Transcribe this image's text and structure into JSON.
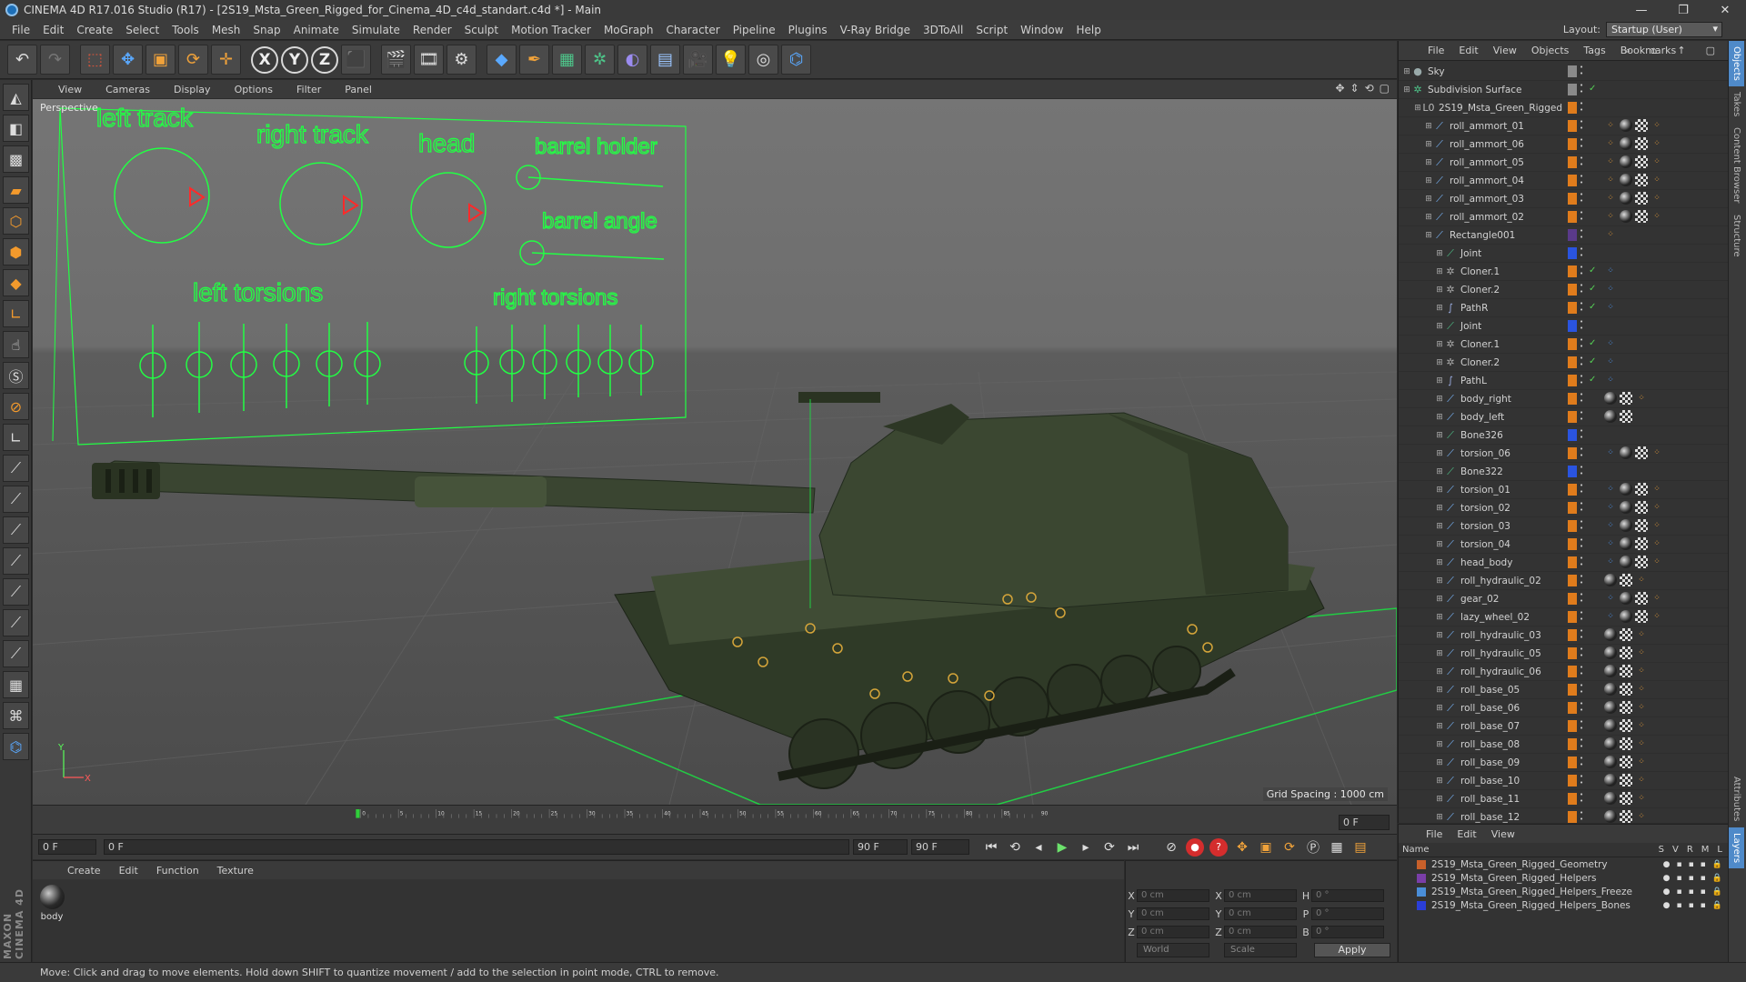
{
  "window": {
    "title": "CINEMA 4D R17.016 Studio (R17) - [2S19_Msta_Green_Rigged_for_Cinema_4D_c4d_standart.c4d *] - Main",
    "controls": [
      "—",
      "❐",
      "✕"
    ]
  },
  "menu": [
    "File",
    "Edit",
    "Create",
    "Select",
    "Tools",
    "Mesh",
    "Snap",
    "Animate",
    "Simulate",
    "Render",
    "Sculpt",
    "Motion Tracker",
    "MoGraph",
    "Character",
    "Pipeline",
    "Plugins",
    "V-Ray Bridge",
    "3DToAll",
    "Script",
    "Window",
    "Help"
  ],
  "layout": {
    "label": "Layout:",
    "value": "Startup (User)"
  },
  "toolbar": {
    "icons": [
      "undo-icon",
      "redo-icon",
      "live-selection-icon",
      "move-icon",
      "scale-icon",
      "rotate-icon",
      "recent-tools-icon",
      "x-axis-lock-icon",
      "y-axis-lock-icon",
      "z-axis-lock-icon",
      "coordinate-system-icon",
      "render-view-icon",
      "render-picture-viewer-icon",
      "edit-render-settings-icon",
      "cube-icon",
      "pen-spline-icon",
      "subdivision-icon",
      "cloner-icon",
      "deformer-icon",
      "floor-icon",
      "camera-icon",
      "light-icon",
      "cinema-logo-icon",
      "python-icon"
    ],
    "xyz": [
      "X",
      "Y",
      "Z"
    ]
  },
  "left_tools": [
    "make-editable-icon",
    "model-mode-icon",
    "texture-mode-icon",
    "workplane-icon",
    "points-mode-icon",
    "edges-mode-icon",
    "polygons-mode-icon",
    "axis-mode-icon",
    "tweak-mode-icon",
    "solo-icon",
    "snap-icon",
    "live-selection-tool-icon",
    "rigging-icon-1",
    "rigging-icon-2",
    "rigging-icon-3",
    "rigging-icon-4",
    "rigging-icon-5",
    "rigging-icon-6",
    "rigging-icon-7",
    "workplane-grid-icon",
    "deform-icon",
    "python-script-icon"
  ],
  "brand": "MAXON CINEMA 4D",
  "viewport": {
    "menu": [
      "View",
      "Cameras",
      "Display",
      "Options",
      "Filter",
      "Panel"
    ],
    "camera": "Perspective",
    "grid_spacing": "Grid Spacing : 1000 cm",
    "hud_labels": {
      "left_track": "left track",
      "right_track": "right track",
      "head": "head",
      "barrel_holder": "barrel holder",
      "barrel_angle": "barrel angle",
      "left_torsions": "left torsions",
      "right_torsions": "right torsions"
    },
    "axis": {
      "y": "Y",
      "x": "X"
    }
  },
  "timeline": {
    "ticks": [
      "0",
      "5",
      "10",
      "15",
      "20",
      "25",
      "30",
      "35",
      "40",
      "45",
      "50",
      "55",
      "60",
      "65",
      "70",
      "75",
      "80",
      "85",
      "90"
    ],
    "current_frame": "0 F",
    "start": "0 F",
    "preview_start": "0 F",
    "preview_end": "90 F",
    "end": "90 F"
  },
  "material_manager": {
    "menu": [
      "Create",
      "Edit",
      "Function",
      "Texture"
    ],
    "materials": [
      {
        "name": "body"
      }
    ]
  },
  "coordinates": {
    "rows": [
      {
        "a": "X",
        "av": "0 cm",
        "b": "X",
        "bv": "0 cm",
        "c": "H",
        "cv": "0 °"
      },
      {
        "a": "Y",
        "av": "0 cm",
        "b": "Y",
        "bv": "0 cm",
        "c": "P",
        "cv": "0 °"
      },
      {
        "a": "Z",
        "av": "0 cm",
        "b": "Z",
        "bv": "0 cm",
        "c": "B",
        "cv": "0 °"
      }
    ],
    "mode1": "World",
    "mode2": "Scale",
    "apply": "Apply"
  },
  "status": "Move: Click and drag to move elements. Hold down SHIFT to quantize movement / add to the selection in point mode, CTRL to remove.",
  "object_manager": {
    "menu": [
      "File",
      "Edit",
      "View",
      "Objects",
      "Tags",
      "Bookmarks"
    ],
    "objects": [
      {
        "name": "Sky",
        "depth": 0,
        "icon": "sky",
        "color": "#8a8a8a",
        "tags": []
      },
      {
        "name": "Subdivision Surface",
        "depth": 0,
        "icon": "subdiv",
        "color": "#8a8a8a",
        "tags": [],
        "check": true
      },
      {
        "name": "2S19_Msta_Green_Rigged",
        "depth": 1,
        "icon": "null",
        "color": "#e07c1c",
        "tags": []
      },
      {
        "name": "roll_ammort_01",
        "depth": 2,
        "icon": "bone",
        "color": "#e07c1c",
        "tags": [
          "dots",
          "ball",
          "check",
          "dots"
        ]
      },
      {
        "name": "roll_ammort_06",
        "depth": 2,
        "icon": "bone",
        "color": "#e07c1c",
        "tags": [
          "dots",
          "ball",
          "check",
          "dots"
        ]
      },
      {
        "name": "roll_ammort_05",
        "depth": 2,
        "icon": "bone",
        "color": "#e07c1c",
        "tags": [
          "dots",
          "ball",
          "check",
          "dots"
        ]
      },
      {
        "name": "roll_ammort_04",
        "depth": 2,
        "icon": "bone",
        "color": "#e07c1c",
        "tags": [
          "dots",
          "ball",
          "check",
          "dots"
        ]
      },
      {
        "name": "roll_ammort_03",
        "depth": 2,
        "icon": "bone",
        "color": "#e07c1c",
        "tags": [
          "dots",
          "ball",
          "check",
          "dots"
        ]
      },
      {
        "name": "roll_ammort_02",
        "depth": 2,
        "icon": "bone",
        "color": "#e07c1c",
        "tags": [
          "dots",
          "ball",
          "check",
          "dots"
        ]
      },
      {
        "name": "Rectangle001",
        "depth": 2,
        "icon": "bone",
        "color": "#5a3a8a",
        "tags": [
          "dots"
        ]
      },
      {
        "name": "Joint",
        "depth": 3,
        "icon": "joint",
        "color": "#2a54e0",
        "tags": []
      },
      {
        "name": "Cloner.1",
        "depth": 3,
        "icon": "cloner",
        "color": "#e07c1c",
        "tags": [
          "blue"
        ],
        "check": true
      },
      {
        "name": "Cloner.2",
        "depth": 3,
        "icon": "cloner",
        "color": "#e07c1c",
        "tags": [
          "blue"
        ],
        "check": true
      },
      {
        "name": "PathR",
        "depth": 3,
        "icon": "spline",
        "color": "#e07c1c",
        "tags": [
          "blue"
        ],
        "check": true
      },
      {
        "name": "Joint",
        "depth": 3,
        "icon": "joint",
        "color": "#2a54e0",
        "tags": []
      },
      {
        "name": "Cloner.1",
        "depth": 3,
        "icon": "cloner",
        "color": "#e07c1c",
        "tags": [
          "blue"
        ],
        "check": true
      },
      {
        "name": "Cloner.2",
        "depth": 3,
        "icon": "cloner",
        "color": "#e07c1c",
        "tags": [
          "blue"
        ],
        "check": true
      },
      {
        "name": "PathL",
        "depth": 3,
        "icon": "spline",
        "color": "#e07c1c",
        "tags": [
          "blue"
        ],
        "check": true
      },
      {
        "name": "body_right",
        "depth": 3,
        "icon": "bone",
        "color": "#e07c1c",
        "tags": [
          "ball",
          "check",
          "dots"
        ]
      },
      {
        "name": "body_left",
        "depth": 3,
        "icon": "bone",
        "color": "#e07c1c",
        "tags": [
          "ball",
          "check"
        ]
      },
      {
        "name": "Bone326",
        "depth": 3,
        "icon": "joint",
        "color": "#2a54e0",
        "tags": []
      },
      {
        "name": "torsion_06",
        "depth": 3,
        "icon": "bone",
        "color": "#e07c1c",
        "tags": [
          "blue",
          "ball",
          "check",
          "dots"
        ]
      },
      {
        "name": "Bone322",
        "depth": 3,
        "icon": "joint",
        "color": "#2a54e0",
        "tags": []
      },
      {
        "name": "torsion_01",
        "depth": 3,
        "icon": "bone",
        "color": "#e07c1c",
        "tags": [
          "blue",
          "ball",
          "check",
          "dots"
        ]
      },
      {
        "name": "torsion_02",
        "depth": 3,
        "icon": "bone",
        "color": "#e07c1c",
        "tags": [
          "blue",
          "ball",
          "check",
          "dots"
        ]
      },
      {
        "name": "torsion_03",
        "depth": 3,
        "icon": "bone",
        "color": "#e07c1c",
        "tags": [
          "blue",
          "ball",
          "check",
          "dots"
        ]
      },
      {
        "name": "torsion_04",
        "depth": 3,
        "icon": "bone",
        "color": "#e07c1c",
        "tags": [
          "blue",
          "ball",
          "check",
          "dots"
        ]
      },
      {
        "name": "head_body",
        "depth": 3,
        "icon": "bone",
        "color": "#e07c1c",
        "tags": [
          "blue",
          "ball",
          "check",
          "dots"
        ]
      },
      {
        "name": "roll_hydraulic_02",
        "depth": 3,
        "icon": "bone",
        "color": "#e07c1c",
        "tags": [
          "ball",
          "check",
          "dots"
        ]
      },
      {
        "name": "gear_02",
        "depth": 3,
        "icon": "bone",
        "color": "#e07c1c",
        "tags": [
          "blue",
          "ball",
          "check",
          "dots"
        ]
      },
      {
        "name": "lazy_wheel_02",
        "depth": 3,
        "icon": "bone",
        "color": "#e07c1c",
        "tags": [
          "blue",
          "ball",
          "check",
          "dots"
        ]
      },
      {
        "name": "roll_hydraulic_03",
        "depth": 3,
        "icon": "bone",
        "color": "#e07c1c",
        "tags": [
          "ball",
          "check",
          "dots"
        ]
      },
      {
        "name": "roll_hydraulic_05",
        "depth": 3,
        "icon": "bone",
        "color": "#e07c1c",
        "tags": [
          "ball",
          "check",
          "dots"
        ]
      },
      {
        "name": "roll_hydraulic_06",
        "depth": 3,
        "icon": "bone",
        "color": "#e07c1c",
        "tags": [
          "ball",
          "check",
          "dots"
        ]
      },
      {
        "name": "roll_base_05",
        "depth": 3,
        "icon": "bone",
        "color": "#e07c1c",
        "tags": [
          "ball",
          "check",
          "dots"
        ]
      },
      {
        "name": "roll_base_06",
        "depth": 3,
        "icon": "bone",
        "color": "#e07c1c",
        "tags": [
          "ball",
          "check",
          "dots"
        ]
      },
      {
        "name": "roll_base_07",
        "depth": 3,
        "icon": "bone",
        "color": "#e07c1c",
        "tags": [
          "ball",
          "check",
          "dots"
        ]
      },
      {
        "name": "roll_base_08",
        "depth": 3,
        "icon": "bone",
        "color": "#e07c1c",
        "tags": [
          "ball",
          "check",
          "dots"
        ]
      },
      {
        "name": "roll_base_09",
        "depth": 3,
        "icon": "bone",
        "color": "#e07c1c",
        "tags": [
          "ball",
          "check",
          "dots"
        ]
      },
      {
        "name": "roll_base_10",
        "depth": 3,
        "icon": "bone",
        "color": "#e07c1c",
        "tags": [
          "ball",
          "check",
          "dots"
        ]
      },
      {
        "name": "roll_base_11",
        "depth": 3,
        "icon": "bone",
        "color": "#e07c1c",
        "tags": [
          "ball",
          "check",
          "dots"
        ]
      },
      {
        "name": "roll_base_12",
        "depth": 3,
        "icon": "bone",
        "color": "#e07c1c",
        "tags": [
          "ball",
          "check",
          "dots"
        ]
      }
    ]
  },
  "layer_manager": {
    "menu": [
      "File",
      "Edit",
      "View"
    ],
    "header": {
      "name": "Name",
      "cols": [
        "S",
        "V",
        "R",
        "M",
        "L"
      ]
    },
    "layers": [
      {
        "name": "2S19_Msta_Green_Rigged_Geometry",
        "color": "#c8602a"
      },
      {
        "name": "2S19_Msta_Green_Rigged_Helpers",
        "color": "#7a3ea8"
      },
      {
        "name": "2S19_Msta_Green_Rigged_Helpers_Freeze",
        "color": "#4a8ed8"
      },
      {
        "name": "2S19_Msta_Green_Rigged_Helpers_Bones",
        "color": "#2a3ed8"
      }
    ]
  },
  "right_tabs": [
    "Objects",
    "Takes",
    "Content Browser",
    "Structure",
    "Attributes",
    "Layers"
  ]
}
